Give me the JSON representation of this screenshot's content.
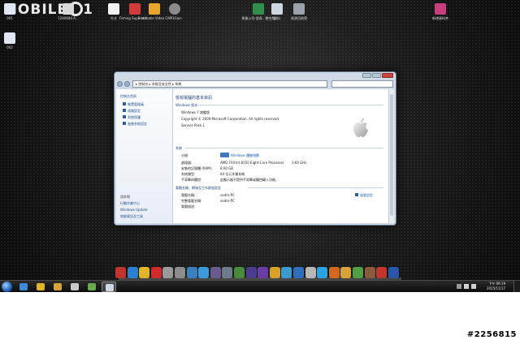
{
  "brand": {
    "text": "MOBILE",
    "suffix": "1"
  },
  "desktop_icons": [
    {
      "label": "001",
      "icon": "monitor-icon",
      "color": "#dfe7f2"
    },
    {
      "label": "1280680.A...",
      "icon": "disk-icon",
      "color": "#d9d9d9"
    },
    {
      "label": "外文",
      "icon": "document-icon",
      "color": "#f2f2f2"
    },
    {
      "label": "Fishing Superstiti...",
      "icon": "pdf-icon",
      "color": "#d23b3b"
    },
    {
      "label": "Freemake Video C...",
      "icon": "freemake-icon",
      "color": "#e7a62a"
    },
    {
      "label": "MP3Gain",
      "icon": "gear-icon",
      "color": "#8b8b8b"
    },
    {
      "label": "興業公司-發表...整合版",
      "icon": "excel-icon",
      "color": "#2f8f4a"
    },
    {
      "label": "雜料",
      "icon": "document-icon",
      "color": "#cfd6df"
    },
    {
      "label": "資源回收筒",
      "icon": "recycle-bin-icon",
      "color": "#9aa3ad"
    },
    {
      "label": "新增資料夾",
      "icon": "winrar-icon",
      "color": "#c93c7e"
    },
    {
      "label": "002",
      "icon": "monitor-icon",
      "color": "#dfe7f2"
    }
  ],
  "window": {
    "breadcrumb": "▸ 控制台 ▸ 系統及安全性 ▸ 系統",
    "search_placeholder": "",
    "left_pane": {
      "home": "控制台首頁",
      "links": [
        "裝置管理員",
        "遠端設定",
        "系統保護",
        "進階系統設定"
      ],
      "see_also_title": "請參閱",
      "see_also": [
        "行動作業中心",
        "Windows Update",
        "效能資訊及工具"
      ]
    },
    "content": {
      "title": "檢視電腦的基本資訊",
      "edition_header": "Windows 版本",
      "edition": "Windows 7 旗艦版",
      "copyright": "Copyright © 2009 Microsoft Corporation. All rights reserved.",
      "service_pack": "Service Pack 1",
      "system_header": "系統",
      "rows": [
        {
          "label": "分級:",
          "value": "Windows 體驗指數"
        },
        {
          "label": "處理器:",
          "value": "AMD FX(tm)-8150 Eight-Core Processor",
          "extra": "3.60 GHz"
        },
        {
          "label": "安裝的記憶體 (RAM):",
          "value": "8.00 GB"
        },
        {
          "label": "系統類型:",
          "value": "64 位元作業系統"
        },
        {
          "label": "手寫筆與觸控:",
          "value": "此顯示器不提供手寫筆或觸控輸入功能。"
        }
      ],
      "network_header": "電腦名稱、網域及工作群組設定",
      "network_rows": [
        {
          "label": "電腦名稱:",
          "value": "xxdm-PC"
        },
        {
          "label": "完整電腦名稱:",
          "value": "xxdm-PC"
        },
        {
          "label": "電腦描述:",
          "value": ""
        }
      ],
      "change_settings": "變更設定"
    }
  },
  "dock": {
    "icons": [
      {
        "name": "adobe-icon",
        "color": "#c0342c"
      },
      {
        "name": "bolt-icon",
        "color": "#2b7fd0"
      },
      {
        "name": "chrome-icon",
        "color": "#e0b52a"
      },
      {
        "name": "opera-icon",
        "color": "#d22b2b"
      },
      {
        "name": "window-icon",
        "color": "#9a9a9a"
      },
      {
        "name": "steam-icon",
        "color": "#8d8d8d"
      },
      {
        "name": "app-icon",
        "color": "#3a7fbf"
      },
      {
        "name": "refresh-icon",
        "color": "#3b9ad9"
      },
      {
        "name": "photos-icon",
        "color": "#6a5a8e"
      },
      {
        "name": "64-icon",
        "color": "#6f7a8a"
      },
      {
        "name": "tools-icon",
        "color": "#4a8a3c"
      },
      {
        "name": "media-icon",
        "color": "#4b3c8f"
      },
      {
        "name": "play-icon",
        "color": "#6b3ca8"
      },
      {
        "name": "character-icon",
        "color": "#d9a02c"
      },
      {
        "name": "mail-icon",
        "color": "#3c9ad0"
      },
      {
        "name": "monitor-icon",
        "color": "#2f6fb8"
      },
      {
        "name": "media-player-icon",
        "color": "#b7b7b7"
      },
      {
        "name": "skype-icon",
        "color": "#2aa4e0"
      },
      {
        "name": "firefox-icon",
        "color": "#d2671f"
      },
      {
        "name": "folder-icon",
        "color": "#d8a23a"
      },
      {
        "name": "leaf-icon",
        "color": "#4fa043"
      },
      {
        "name": "cat-icon",
        "color": "#8a5a3a"
      },
      {
        "name": "game-icon",
        "color": "#c4342e"
      },
      {
        "name": "l-icon",
        "color": "#2a55a8"
      }
    ]
  },
  "taskbar": {
    "items": [
      {
        "name": "taskbar-ie-icon",
        "color": "#3f8ad8"
      },
      {
        "name": "taskbar-chrome-icon",
        "color": "#e0b52a"
      },
      {
        "name": "taskbar-folder-icon",
        "color": "#d8a23a"
      },
      {
        "name": "taskbar-library-icon",
        "color": "#c8c8c8"
      },
      {
        "name": "taskbar-photos-icon",
        "color": "#6aa84f"
      },
      {
        "name": "taskbar-system-icon",
        "color": "#cfd9e5"
      }
    ],
    "clock_time": "下午 09:19",
    "clock_date": "2015/11/17"
  },
  "watermark": "#2256815"
}
